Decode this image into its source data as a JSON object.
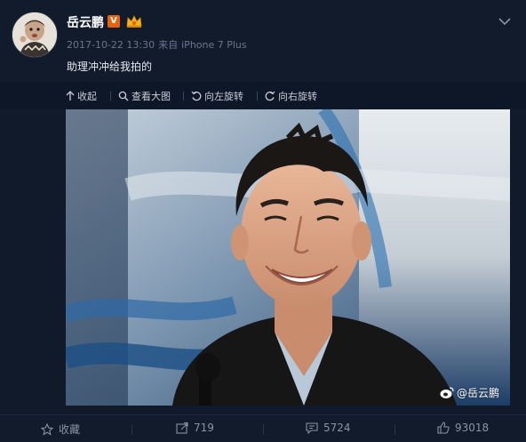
{
  "post": {
    "username": "岳云鹏",
    "verified_badge": "V",
    "timestamp": "2017-10-22 13:30",
    "source_prefix": "来自",
    "source": "iPhone 7 Plus",
    "text": "助理冲冲给我拍的"
  },
  "media_toolbar": {
    "collapse": "收起",
    "view_large": "查看大图",
    "rotate_left": "向左旋转",
    "rotate_right": "向右旋转"
  },
  "image": {
    "watermark": "@岳云鹏"
  },
  "actions": {
    "favorite": "收藏",
    "repost_count": "719",
    "comment_count": "5724",
    "like_count": "93018"
  },
  "icons": [
    "chevron-down-icon",
    "collapse-up-icon",
    "search-icon",
    "rotate-left-icon",
    "rotate-right-icon",
    "star-icon",
    "repost-icon",
    "comment-icon",
    "like-icon",
    "weibo-logo-icon"
  ],
  "colors": {
    "background": "#101a2a",
    "verified_badge": "#e8620b",
    "muted_text": "#6c7686"
  }
}
